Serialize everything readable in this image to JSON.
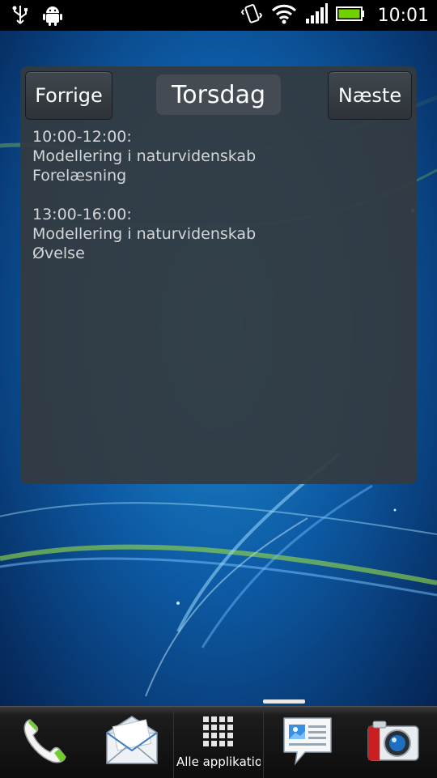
{
  "status_bar": {
    "time": "10:01",
    "icons": [
      "usb-icon",
      "android-debug-icon",
      "vibrate-icon",
      "wifi-icon",
      "signal-icon",
      "battery-icon"
    ]
  },
  "widget": {
    "prev_label": "Forrige",
    "day_title": "Torsdag",
    "next_label": "Næste",
    "events": [
      {
        "time": "10:00-12:00:",
        "course": "Modellering i naturvidenskab",
        "type": "Forelæsning"
      },
      {
        "time": "13:00-16:00:",
        "course": "Modellering i naturvidenskab",
        "type": "Øvelse"
      }
    ]
  },
  "dock": {
    "items": [
      "phone-icon",
      "mail-icon",
      "all-apps-icon",
      "messages-icon",
      "camera-icon"
    ],
    "apps_label": "Alle applikatio"
  },
  "colors": {
    "widget_bg": "#343a40",
    "status_bar": "#000000",
    "battery": "#6fd100"
  }
}
